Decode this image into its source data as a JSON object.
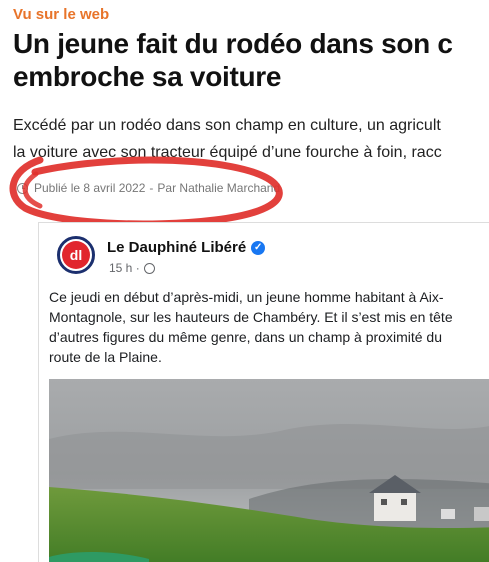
{
  "article": {
    "kicker": "Vu sur le web",
    "headline_lines": [
      "Un jeune fait du rodéo dans son c",
      "embroche sa voiture"
    ],
    "lede_lines": [
      "Excédé par un rodéo dans son champ en culture, un agricult",
      "la voiture avec son tracteur équipé d’une fourche à foin, racc"
    ],
    "meta": {
      "published": "Publié le 8 avril 2022",
      "separator": "-",
      "author": "Par Nathalie Marchand"
    }
  },
  "post": {
    "logo_text": "dl",
    "page_name": "Le Dauphiné Libéré",
    "verified_mark": "✓",
    "time": "15 h ·",
    "text_lines": [
      "Ce jeudi en début d’après-midi, un jeune homme habitant à Aix-",
      "Montagnole, sur les hauteurs de Chambéry. Et il s’est mis en tête",
      "d’autres figures du même genre, dans un champ à proximité du",
      "route de la Plaine."
    ]
  },
  "colors": {
    "kicker": "#e8742a",
    "scribble": "#e0302b",
    "verified": "#1877f2",
    "logo_ring": "#1b2f6e",
    "logo_fill": "#e1262d"
  }
}
